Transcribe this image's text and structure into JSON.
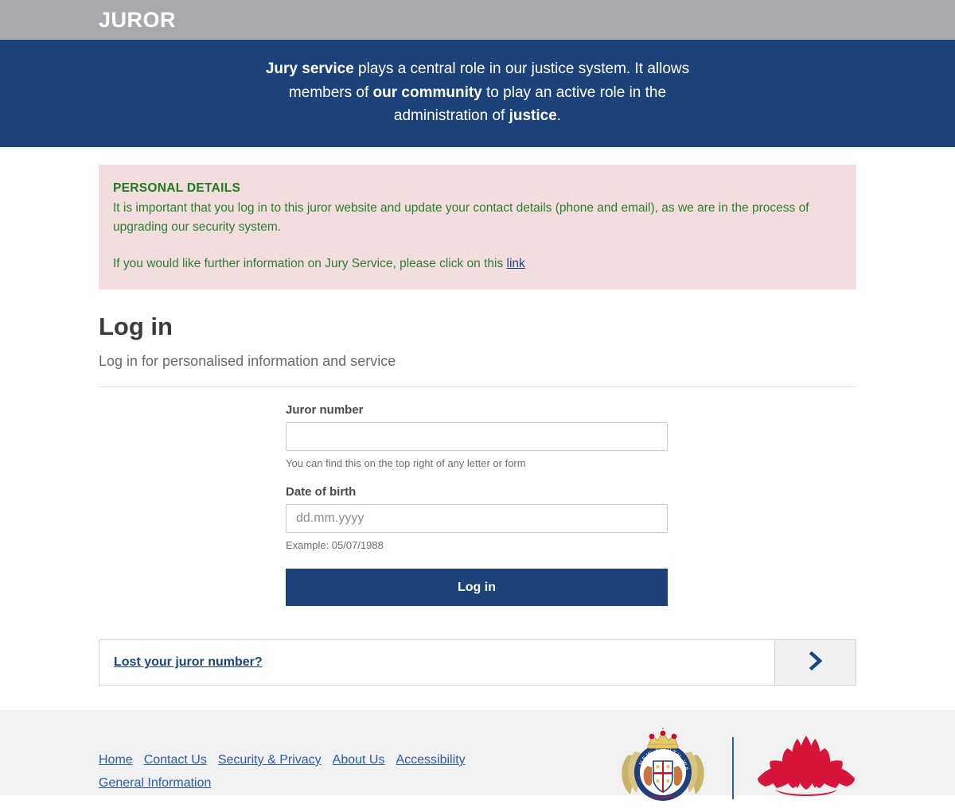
{
  "header": {
    "brand": "JUROR"
  },
  "hero": {
    "line1_bold": "Jury service",
    "line1_rest": " plays a central role in our justice system. It allows",
    "line2_pre": "members of ",
    "line2_bold": "our community",
    "line2_rest": " to play an active role in the",
    "line3_pre": "administration of ",
    "line3_bold": "justice",
    "line3_rest": "."
  },
  "alert": {
    "title": "PERSONAL DETAILS",
    "body": "It is important that you log in to this juror website and update your contact details (phone and email), as we are in the process of upgrading our security system.",
    "second_pre": "If you would like further information on Jury Service, please click on this ",
    "link_label": "link",
    "bg_color": "#f2dede",
    "text_color": "#2e7d32"
  },
  "login": {
    "heading": "Log in",
    "subheading": "Log in for personalised information and service",
    "juror_number": {
      "label": "Juror number",
      "value": "",
      "placeholder": "",
      "hint": "You can find this on the top right of any letter or form"
    },
    "date_of_birth": {
      "label": "Date of birth",
      "value": "",
      "placeholder": "dd.mm.yyyy",
      "hint": "Example: 05/07/1988"
    },
    "submit_label": "Log in",
    "submit_color": "#1b4379"
  },
  "lost_juror": {
    "label": "Lost your juror number?",
    "arrow_icon": "chevron-right-icon"
  },
  "footer": {
    "links": [
      "Home",
      "Contact Us",
      "Security & Privacy",
      "About Us",
      "Accessibility",
      "General Information"
    ],
    "logos": {
      "coat_of_arms": "nsw-coat-of-arms-logo",
      "coat_of_arms_text": "NEW SOUTH WALES",
      "waratah": "nsw-waratah-logo",
      "waratah_color": "#d7153a"
    },
    "bg_color": "#f1f1f1"
  }
}
